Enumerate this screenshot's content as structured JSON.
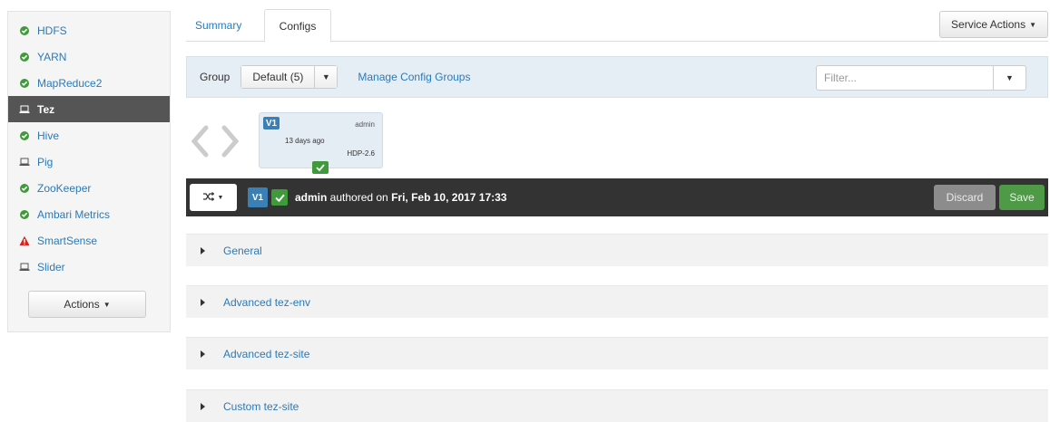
{
  "sidebar": {
    "services": [
      {
        "name": "HDFS",
        "status": "ok"
      },
      {
        "name": "YARN",
        "status": "ok"
      },
      {
        "name": "MapReduce2",
        "status": "ok"
      },
      {
        "name": "Tez",
        "status": "client",
        "active": true
      },
      {
        "name": "Hive",
        "status": "ok"
      },
      {
        "name": "Pig",
        "status": "client"
      },
      {
        "name": "ZooKeeper",
        "status": "ok"
      },
      {
        "name": "Ambari Metrics",
        "status": "ok"
      },
      {
        "name": "SmartSense",
        "status": "alert"
      },
      {
        "name": "Slider",
        "status": "client"
      }
    ],
    "actions_label": "Actions"
  },
  "tabs": {
    "summary": "Summary",
    "configs": "Configs"
  },
  "service_actions_label": "Service Actions",
  "group_bar": {
    "label": "Group",
    "selected": "Default (5)",
    "manage_link": "Manage Config Groups",
    "filter_placeholder": "Filter..."
  },
  "version_card": {
    "badge": "V1",
    "author": "admin",
    "time": "13 days ago",
    "stack": "HDP-2.6"
  },
  "version_bar": {
    "badge": "V1",
    "author": "admin",
    "authored_text": " authored on ",
    "date": "Fri, Feb 10, 2017 17:33",
    "discard_label": "Discard",
    "save_label": "Save"
  },
  "sections": [
    "General",
    "Advanced tez-env",
    "Advanced tez-site",
    "Custom tez-site"
  ],
  "colors": {
    "ok": "#3f9a3b",
    "alert": "#d9231f",
    "link": "#2a7ab8",
    "active_bg": "#555555",
    "badge": "#3a7fb6"
  }
}
